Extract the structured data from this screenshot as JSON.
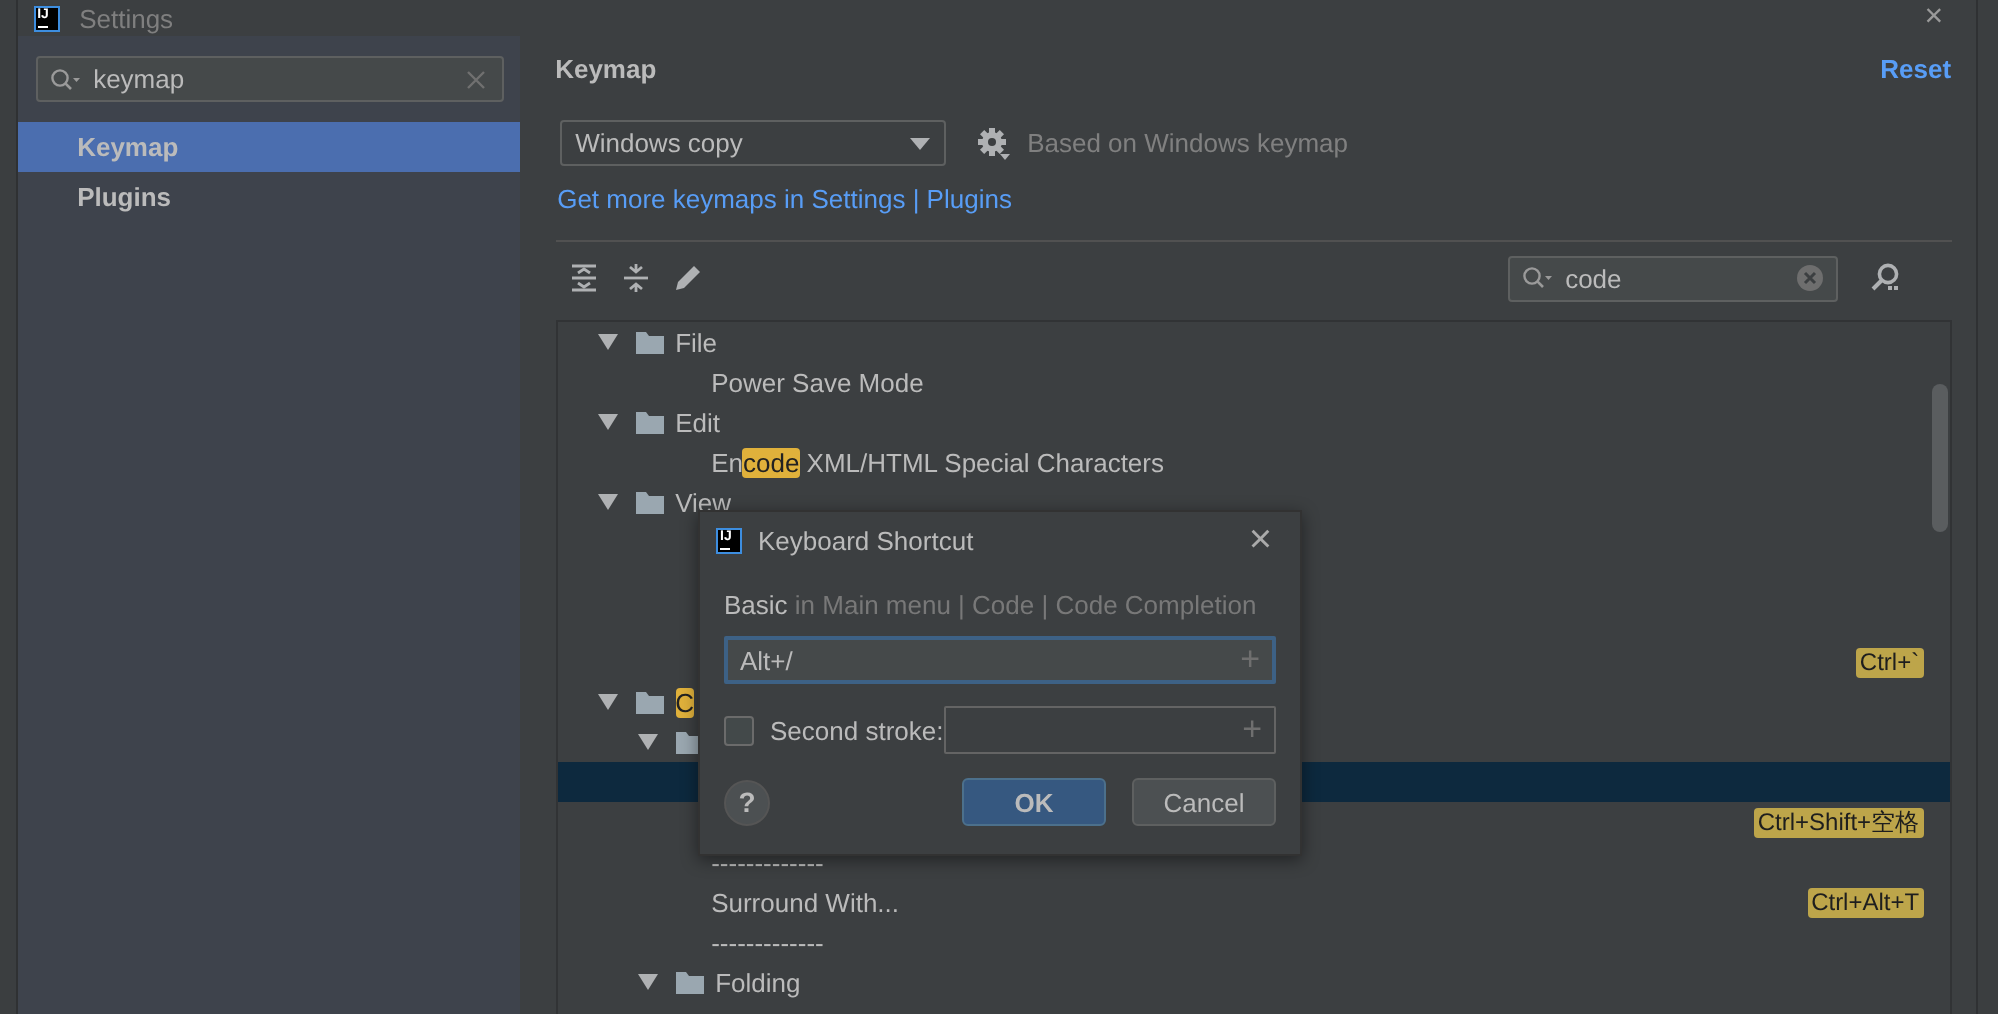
{
  "window": {
    "icon_text": "IJ",
    "title": "Settings",
    "close": "×"
  },
  "sidebar": {
    "search": {
      "value": "keymap"
    },
    "items": [
      {
        "label": "Keymap",
        "selected": true
      },
      {
        "label": "Plugins",
        "selected": false
      }
    ]
  },
  "panel": {
    "title": "Keymap",
    "reset": "Reset",
    "keymap_select": {
      "value": "Windows copy"
    },
    "based_on": "Based on Windows keymap",
    "link": "Get more keymaps in Settings | Plugins",
    "tree_search": {
      "value": "code"
    },
    "tree": [
      {
        "kind": "folder",
        "label": "File",
        "expanded": true,
        "selected": false,
        "children": [
          {
            "label": "Power Save Mode",
            "selected": false
          }
        ]
      },
      {
        "kind": "folder",
        "label": "Edit",
        "expanded": true,
        "selected": false,
        "children": [
          {
            "text_before": "En",
            "match": "code",
            "text_after": " XML/HTML Special Characters",
            "selected": false
          }
        ]
      },
      {
        "kind": "folder",
        "label": "View",
        "expanded": true,
        "selected": false,
        "children": [
          {
            "selected": false
          },
          {
            "selected": false
          },
          {
            "selected": false
          },
          {
            "shortcut": "Ctrl+`",
            "selected": false
          }
        ]
      },
      {
        "kind": "folder",
        "match": "C",
        "expanded": true,
        "selected": false,
        "children": [
          {
            "kind": "folder",
            "expanded": true,
            "selected": false,
            "children": [
              {
                "selected": true
              },
              {
                "shortcut": "Ctrl+Shift+空格",
                "selected": false
              },
              {
                "label": "-------------",
                "selected": false
              },
              {
                "label": "Surround With...",
                "shortcut": "Ctrl+Alt+T",
                "selected": false
              },
              {
                "label": "-------------",
                "selected": false
              }
            ]
          },
          {
            "kind": "folder",
            "label": "Folding",
            "expanded": true,
            "selected": false
          }
        ]
      }
    ]
  },
  "dialog": {
    "icon_text": "IJ",
    "title": "Keyboard Shortcut",
    "close": "×",
    "context_strong": "Basic",
    "context": "in Main menu | Code | Code Completion",
    "first_stroke": {
      "value": "Alt+/",
      "add": "+"
    },
    "second_stroke": {
      "label": "Second stroke:",
      "checked": false,
      "add": "+"
    },
    "help": "?",
    "ok": "OK",
    "cancel": "Cancel"
  }
}
